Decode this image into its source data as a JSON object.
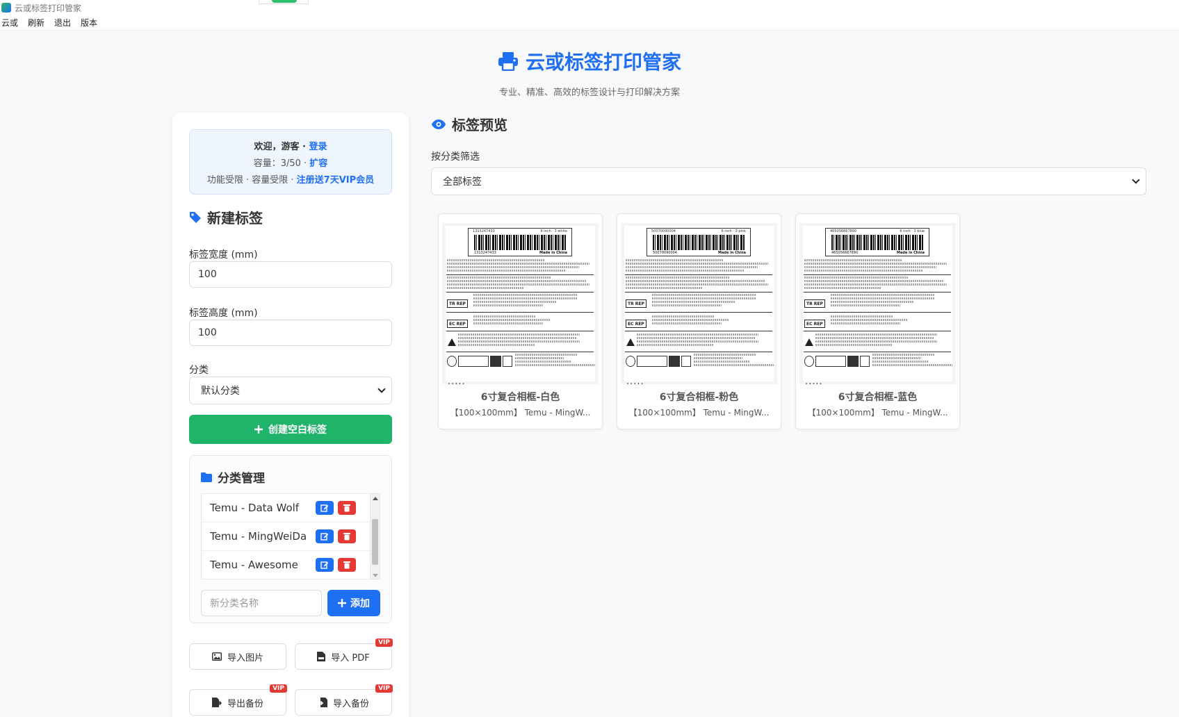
{
  "window": {
    "title": "云或标签打印管家"
  },
  "menu": [
    "云或",
    "刷新",
    "退出",
    "版本"
  ],
  "header": {
    "title": "云或标签打印管家",
    "subtitle": "专业、精准、高效的标签设计与打印解决方案"
  },
  "welcome": {
    "greeting": "欢迎，游客 · ",
    "login": "登录",
    "capacity": "容量：3/50 · ",
    "expand": "扩容",
    "limits": "功能受限 · 容量受限 · ",
    "vip_offer": "注册送7天VIP会员"
  },
  "new_label": {
    "title": "新建标签",
    "width_label": "标签宽度 (mm)",
    "width_value": "100",
    "height_label": "标签高度 (mm)",
    "height_value": "100",
    "category_label": "分类",
    "category_value": "默认分类",
    "create_button": "创建空白标签"
  },
  "category_manager": {
    "title": "分类管理",
    "items": [
      {
        "name": "Temu - Data Wolf"
      },
      {
        "name": "Temu - MingWeiDa"
      },
      {
        "name": "Temu - Awesome"
      }
    ],
    "new_placeholder": "新分类名称",
    "add_button": "添加"
  },
  "tools": {
    "import_image": "导入图片",
    "import_pdf": "导入 PDF",
    "export_backup": "导出备份",
    "import_backup": "导入备份",
    "vip_badge": "VIP"
  },
  "preview": {
    "title": "标签预览",
    "filter_label": "按分类筛选",
    "filter_value": "全部标签",
    "cards": [
      {
        "dots": ".....",
        "name": "6寸复合相框-白色",
        "meta": "【100×100mm】 Temu - MingW...",
        "code": "1313247433",
        "variant": "6 inch · 3 white"
      },
      {
        "dots": ".....",
        "name": "6寸复合相框-粉色",
        "meta": "【100×100mm】 Temu - MingW...",
        "code": "50070090004",
        "variant": "6 inch · 3 pink"
      },
      {
        "dots": ".....",
        "name": "6寸复合相框-蓝色",
        "meta": "【100×100mm】 Temu - MingW...",
        "code": "465056667890",
        "variant": "6 inch · 3 blue"
      }
    ],
    "label_texts": {
      "made_in": "Made in China",
      "tr_rep": "TR REP",
      "ec_rep": "EC REP"
    }
  },
  "colors": {
    "primary": "#1e6ff2",
    "success": "#20b46b",
    "danger": "#e53935"
  }
}
